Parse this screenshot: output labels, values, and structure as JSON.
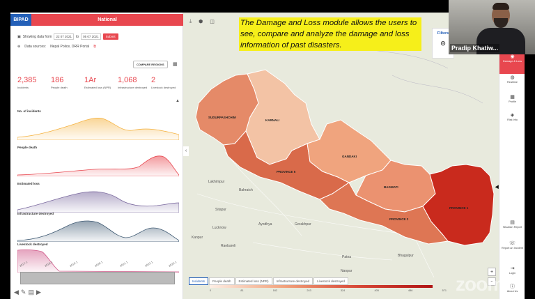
{
  "app": {
    "logo": "BIPAD",
    "region": "National"
  },
  "filter": {
    "showing_label": "Showing data from",
    "from_date": "22 07 2021",
    "to_label": "to",
    "to_date": "05 07 2021",
    "submit": "Submit",
    "sources_label": "Data sources:",
    "sources_value": "Nepal Police, DRR Portal"
  },
  "compare_button": "COMPARE REGIONS",
  "stats": [
    {
      "value": "2,385",
      "label": "Incidents"
    },
    {
      "value": "186",
      "label": "People death"
    },
    {
      "value": "1Ar",
      "label": "Estimated loss (NPR)"
    },
    {
      "value": "1,068",
      "label": "Infrastructure destroyed"
    },
    {
      "value": "2",
      "label": "Livestock destroyed"
    }
  ],
  "charts": {
    "series": [
      {
        "name": "No. of incidents",
        "color": "#f5b342"
      },
      {
        "name": "People death",
        "color": "#e8474f"
      },
      {
        "name": "Estimated loss",
        "color": "#7b6a9f"
      },
      {
        "name": "Infrastructure destroyed",
        "color": "#3f5a73"
      },
      {
        "name": "Livestock destroyed",
        "color": "#d05a8a"
      }
    ],
    "x_labels": [
      "2017-1",
      "2018-1",
      "2019-1",
      "2020-1",
      "2021-1",
      "2022-1",
      "2023-1"
    ]
  },
  "caption": "The Damage and Loss module allows the users to see, compare and analyze the damage and loss information of past disasters.",
  "map": {
    "provinces": [
      {
        "name": "SUDURPASHCHIM",
        "color": "#e58a68"
      },
      {
        "name": "KARNALI",
        "color": "#f3c3a5"
      },
      {
        "name": "PROVINCE 5",
        "color": "#d96a4a"
      },
      {
        "name": "GANDAKI",
        "color": "#f0a47e"
      },
      {
        "name": "BAGMATI",
        "color": "#eb9270"
      },
      {
        "name": "PROVINCE 2",
        "color": "#de7654"
      },
      {
        "name": "PROVINCE 1",
        "color": "#c92a1d"
      }
    ],
    "cities": [
      "Lakhimpur",
      "Bahraich",
      "Sitapur",
      "Lucknow",
      "Kanpur",
      "Ayodhya",
      "Gorakhpur",
      "Patna",
      "Bhagalpur",
      "Raebareli",
      "Nanpur"
    ],
    "legend_tabs": [
      "Incidents",
      "People death",
      "Estimated loss (NPR)",
      "Infrastructure destroyed",
      "Livestock destroyed"
    ],
    "legend_values": [
      "0",
      "81",
      "162",
      "243",
      "324",
      "405",
      "486",
      "571"
    ]
  },
  "filters_button": "Filters",
  "right_nav": [
    {
      "label": "Damage & Loss",
      "icon": "◉"
    },
    {
      "label": "Realtime",
      "icon": "◍"
    },
    {
      "label": "Profile",
      "icon": "▦"
    },
    {
      "label": "Risk Info",
      "icon": "◈"
    },
    {
      "label": "Situation Report",
      "icon": "▤"
    },
    {
      "label": "Report an Incident",
      "icon": "☏"
    },
    {
      "label": "Login",
      "icon": "⇥"
    },
    {
      "label": "About Us",
      "icon": "ⓘ"
    }
  ],
  "video": {
    "name": "Pradip Khatiw..."
  },
  "watermark": "zoom"
}
